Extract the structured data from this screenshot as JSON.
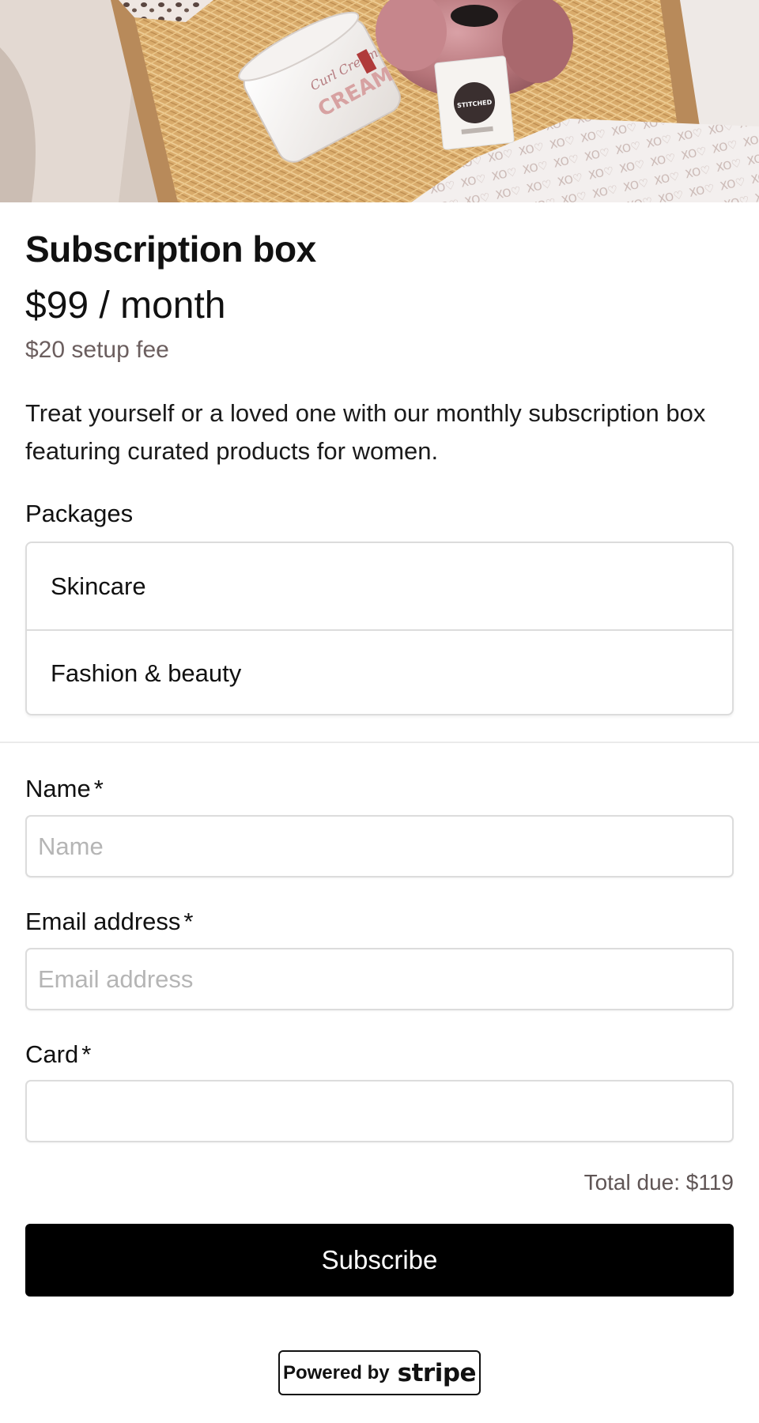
{
  "hero": {
    "jar_label_script": "Curl Cream",
    "jar_label": "CREAM",
    "tag_label": "STITCHED"
  },
  "product": {
    "title": "Subscription box",
    "price": "$99 / month",
    "setup_fee": "$20 setup fee",
    "description": "Treat yourself or a loved one with our monthly subscription box featuring curated products for women."
  },
  "packages": {
    "label": "Packages",
    "options": [
      {
        "label": "Skincare"
      },
      {
        "label": "Fashion & beauty"
      }
    ]
  },
  "form": {
    "name": {
      "label": "Name",
      "required_mark": "*",
      "placeholder": "Name",
      "value": ""
    },
    "email": {
      "label": "Email address",
      "required_mark": "*",
      "placeholder": "Email address",
      "value": ""
    },
    "card": {
      "label": "Card",
      "required_mark": "*",
      "value": ""
    }
  },
  "summary": {
    "total_due": "Total due: $119"
  },
  "actions": {
    "subscribe_label": "Subscribe"
  },
  "footer": {
    "powered_by": "Powered by",
    "brand": "stripe"
  },
  "colors": {
    "button_bg": "#000000",
    "muted_text": "#6b5e5e",
    "border": "#dcdcdc"
  }
}
